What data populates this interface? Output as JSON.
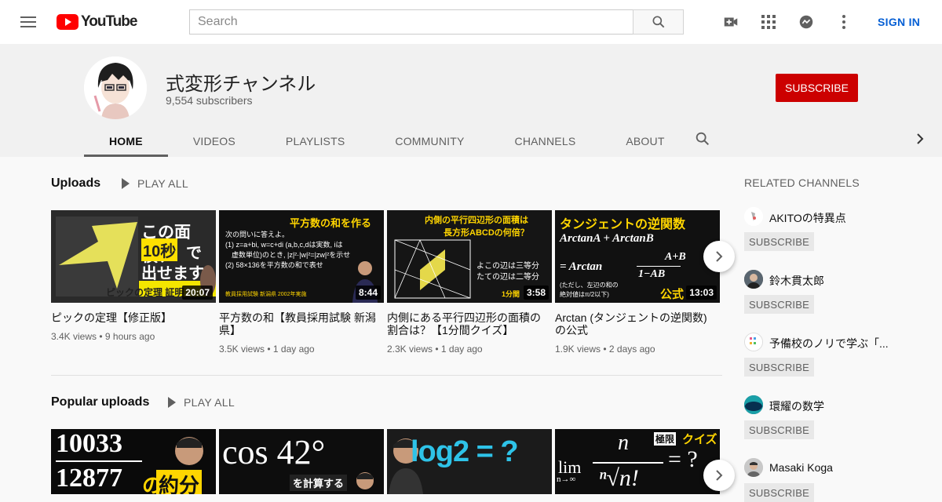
{
  "topbar": {
    "logo_text": "YouTube",
    "search_placeholder": "Search",
    "signin_label": "SIGN IN",
    "icons": [
      "menu-icon",
      "search-icon",
      "create-video-icon",
      "apps-icon",
      "messages-icon",
      "more-icon"
    ]
  },
  "channel": {
    "name": "式変形チャンネル",
    "subscribers": "9,554 subscribers",
    "subscribe_label": "SUBSCRIBE"
  },
  "tabs": [
    "HOME",
    "VIDEOS",
    "PLAYLISTS",
    "COMMUNITY",
    "CHANNELS",
    "ABOUT"
  ],
  "uploads": {
    "title": "Uploads",
    "play_all": "PLAY ALL",
    "videos": [
      {
        "title": "ピックの定理【修正版】",
        "meta": "3.4K views • 9 hours ago",
        "duration": "20:07",
        "thumb_text": [
          "この面積、",
          "10秒",
          "で",
          "出せます",
          "ピックの定理 証明"
        ]
      },
      {
        "title": "平方数の和【教員採用試験 新潟県】",
        "meta": "3.5K views • 1 day ago",
        "duration": "8:44",
        "thumb_text": [
          "平方数の和を作る",
          "次の問いに答えよ。",
          "(1) z=a+bi, w=c+di (a,b,c,dは実数, iは",
          "虚数単位)のとき, |z|²·|w|²=|zw|²を示せ",
          "(2) 58×136を平方数の和で表せ",
          "教員採用試験 新潟県 2002年実施"
        ]
      },
      {
        "title": "内側にある平行四辺形の面積の割合は？【1分間クイズ】",
        "meta": "2.3K views • 1 day ago",
        "duration": "3:58",
        "thumb_text": [
          "内側の平行四辺形の面積は",
          "長方形ABCDの何倍？",
          "よこの辺は三等分",
          "たての辺は二等分",
          "1分間"
        ]
      },
      {
        "title": "Arctan (タンジェントの逆関数)の公式",
        "meta": "1.9K views • 2 days ago",
        "duration": "13:03",
        "thumb_text": [
          "タンジェントの逆関数",
          "ArctanA + ArctanB",
          "= Arctan",
          "A+B",
          "1−AB",
          "(ただし、左辺の和の",
          "絶対値はπ/2以下)",
          "公式"
        ]
      }
    ]
  },
  "popular": {
    "title": "Popular uploads",
    "play_all": "PLAY ALL",
    "thumbs": [
      {
        "thumb_text": [
          "10033",
          "12877",
          "の",
          "約分"
        ]
      },
      {
        "thumb_text": [
          "cos 42°",
          "を計算する"
        ]
      },
      {
        "thumb_text": [
          "log2 = ?"
        ]
      },
      {
        "thumb_text": [
          "極限",
          "クイズ",
          "lim",
          "n→∞",
          "n",
          "ⁿ√n!",
          "= ?"
        ]
      }
    ]
  },
  "related": {
    "heading": "RELATED CHANNELS",
    "subscribe_label": "SUBSCRIBE",
    "channels": [
      {
        "name": "AKITOの特異点"
      },
      {
        "name": "鈴木貫太郎"
      },
      {
        "name": "予備校のノリで学ぶ「..."
      },
      {
        "name": "環耀の数学"
      },
      {
        "name": "Masaki Koga"
      }
    ]
  },
  "colors": {
    "brand_red": "#ff0000",
    "subscribe_red": "#cc0000",
    "link_blue": "#065fd4"
  }
}
